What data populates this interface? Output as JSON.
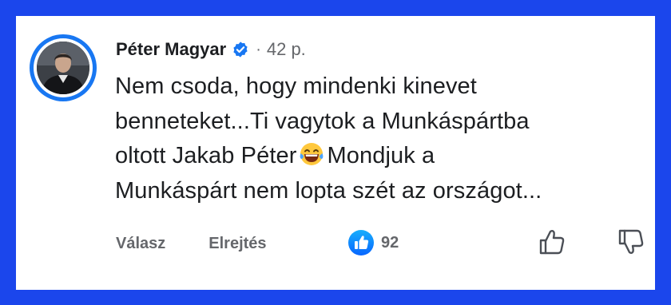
{
  "comment": {
    "author": "Péter Magyar",
    "separator": "·",
    "time": "42 p.",
    "lines": [
      "Nem csoda, hogy mindenki kinevet",
      "benneteket...Ti vagytok a Munkáspártba",
      "oltott Jakab Péter",
      "Mondjuk a",
      "Munkáspárt nem lopta szét az országot..."
    ],
    "emoji": "face-with-tears-of-joy"
  },
  "actions": {
    "reply_label": "Válasz",
    "hide_label": "Elrejtés"
  },
  "reactions": {
    "type": "like",
    "count": "92"
  },
  "icons": {
    "verified": "verified-badge-icon",
    "like": "like-thumb-icon",
    "upvote": "thumbs-up-outline-icon",
    "downvote": "thumbs-down-outline-icon"
  },
  "colors": {
    "frame": "#1b46ec",
    "accent": "#1877f2",
    "text": "#1c1e21",
    "muted": "#65676b"
  }
}
